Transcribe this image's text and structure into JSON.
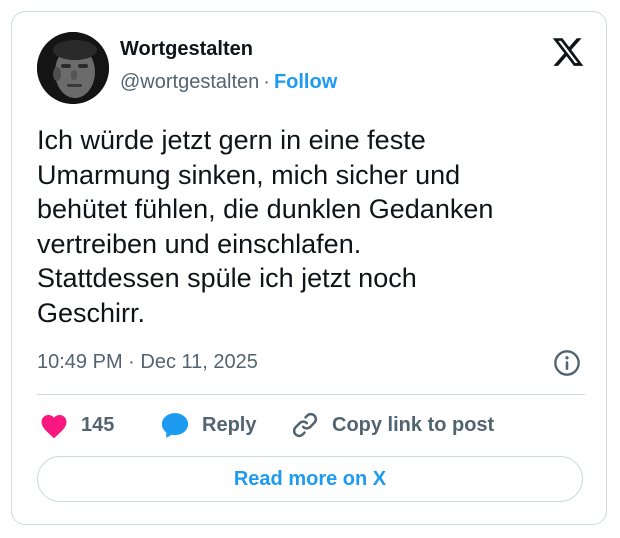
{
  "author": {
    "name": "Wortgestalten",
    "handle": "@wortgestalten",
    "separator": "·",
    "follow_label": "Follow"
  },
  "post": {
    "lines": [
      "Ich würde jetzt gern in eine feste",
      "Umarmung sinken, mich sicher und",
      "behütet fühlen, die dunklen Gedanken",
      "vertreiben und einschlafen.",
      "Stattdessen spüle ich jetzt noch",
      "Geschirr."
    ],
    "timestamp": "10:49 PM · Dec 11, 2025"
  },
  "actions": {
    "like_count": "145",
    "reply_label": "Reply",
    "copy_label": "Copy link to post"
  },
  "footer": {
    "read_more_label": "Read more on X"
  },
  "icons": {
    "logo": "x-logo-icon",
    "info": "info-icon",
    "like": "heart-icon",
    "reply": "speech-bubble-icon",
    "copy": "link-icon"
  },
  "colors": {
    "accent": "#1d9bf0",
    "like": "#f91880",
    "text": "#0f1419",
    "secondary": "#536471",
    "border": "#cfd9de"
  }
}
